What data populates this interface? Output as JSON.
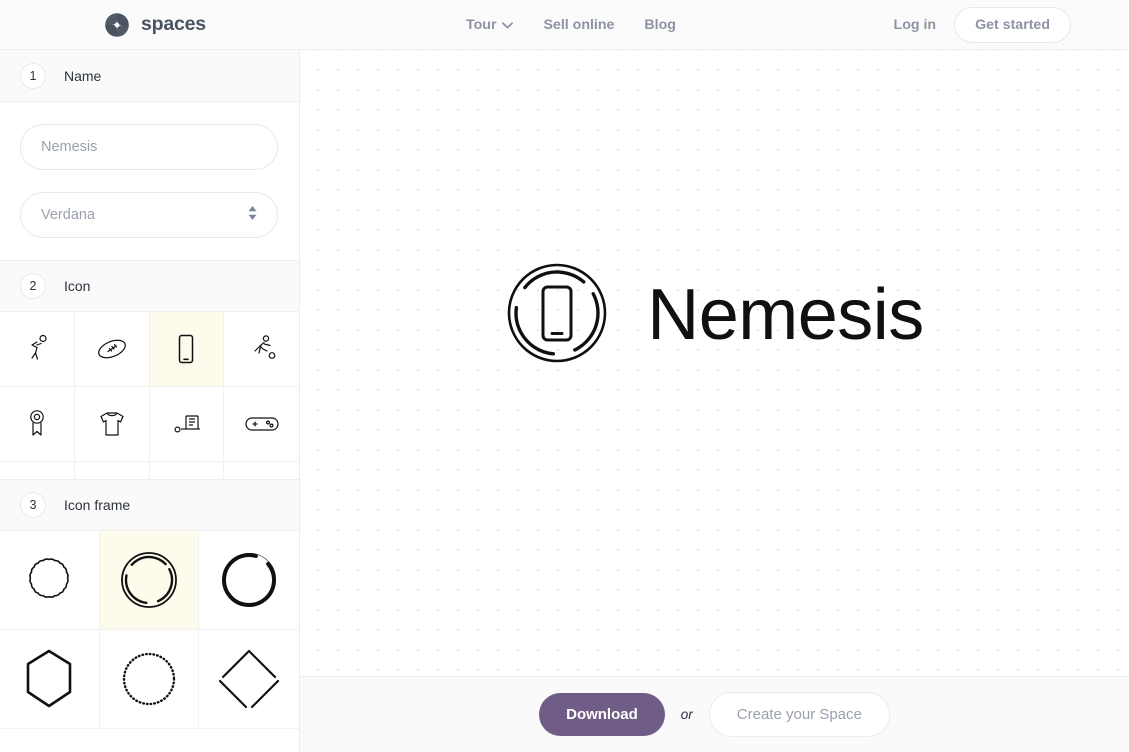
{
  "nav": {
    "brand": "spaces",
    "brand_icon": "spaces-pinwheel-logo",
    "links": [
      {
        "label": "Tour",
        "icon": "chevron-down-icon",
        "has_caret": true
      },
      {
        "label": "Sell online",
        "has_caret": false
      },
      {
        "label": "Blog",
        "has_caret": false
      }
    ],
    "login_label": "Log in",
    "get_started_label": "Get started"
  },
  "sidebar": {
    "sections": [
      {
        "number": "1",
        "title": "Name"
      },
      {
        "number": "2",
        "title": "Icon"
      },
      {
        "number": "3",
        "title": "Icon frame"
      }
    ],
    "name_field": {
      "placeholder": "Nemesis",
      "value": ""
    },
    "font_field": {
      "placeholder": "Verdana",
      "value": "",
      "icon": "select-updown-arrows-icon"
    },
    "icons": [
      {
        "name": "basketball-player-icon",
        "selected": false
      },
      {
        "name": "rugby-ball-icon",
        "selected": false
      },
      {
        "name": "smartphone-icon",
        "selected": true
      },
      {
        "name": "soccer-player-icon",
        "selected": false
      },
      {
        "name": "award-medal-icon",
        "selected": false
      },
      {
        "name": "tshirt-icon",
        "selected": false
      },
      {
        "name": "delivery-truck-icon",
        "selected": false
      },
      {
        "name": "gamepad-icon",
        "selected": false
      },
      {
        "name": "thermometer-icon",
        "selected": false
      },
      {
        "name": "skyline-icon",
        "selected": false
      },
      {
        "name": "handbag-icon",
        "selected": false
      },
      {
        "name": "compact-disc-icon",
        "selected": false
      }
    ],
    "frames": [
      {
        "name": "scalloped-circle-frame",
        "selected": false
      },
      {
        "name": "double-ring-circle-frame",
        "selected": true
      },
      {
        "name": "bold-brush-circle-frame",
        "selected": false
      },
      {
        "name": "rounded-hexagon-frame",
        "selected": false
      },
      {
        "name": "dotted-circle-frame",
        "selected": false
      },
      {
        "name": "diamond-frame",
        "selected": false
      }
    ]
  },
  "canvas": {
    "logo_text": "Nemesis",
    "logo_icon": "smartphone-icon",
    "logo_frame": "double-ring-circle-frame",
    "background": "dot-grid"
  },
  "bottombar": {
    "download_label": "Download",
    "or_label": "or",
    "create_label": "Create your Space"
  },
  "colors": {
    "accent_purple": "#6f5c87",
    "selected_cell": "#fdfcec",
    "nav_text": "#8c93a3",
    "dot_grid": "#e6e6e6"
  }
}
